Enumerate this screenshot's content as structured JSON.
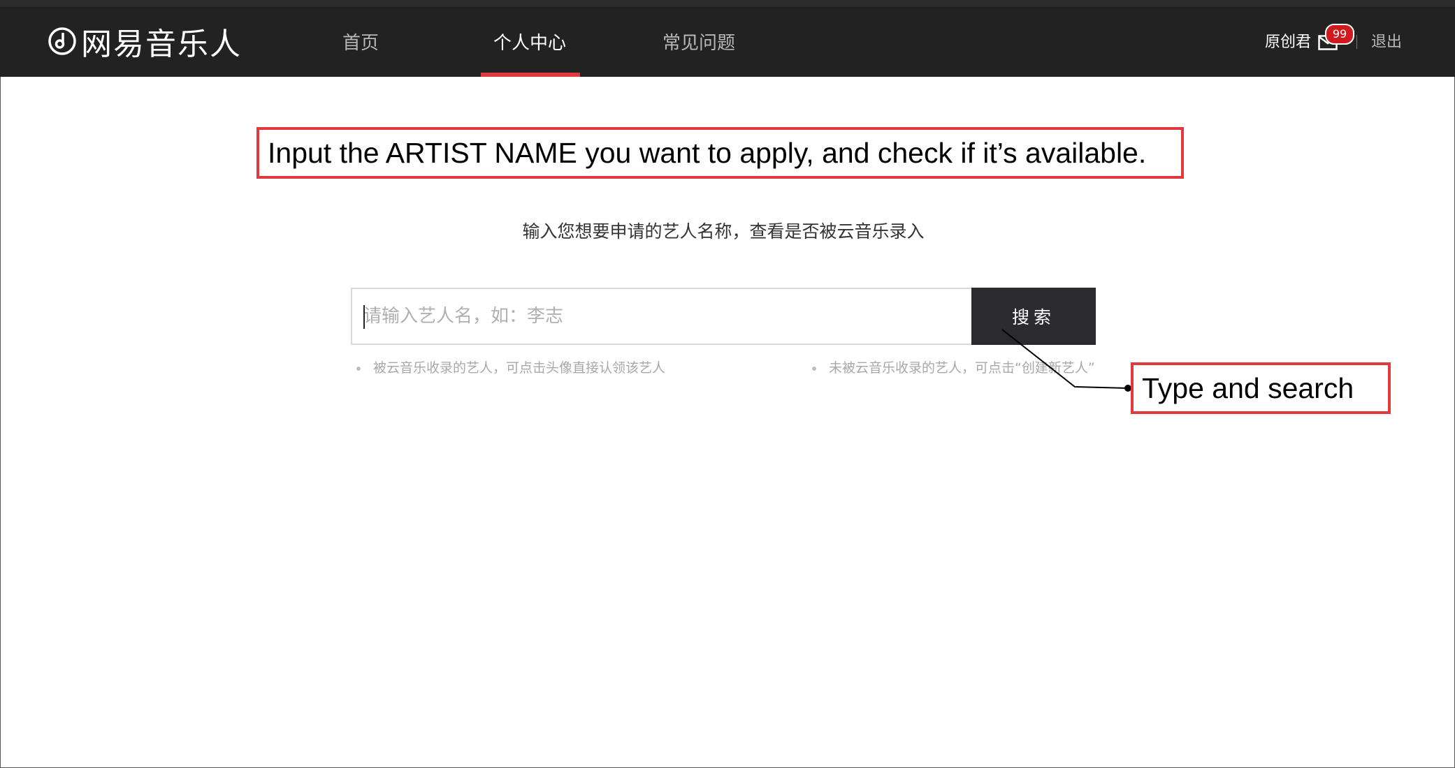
{
  "header": {
    "logo_text": "网易音乐人",
    "nav": [
      {
        "label": "首页",
        "active": false
      },
      {
        "label": "个人中心",
        "active": true
      },
      {
        "label": "常见问题",
        "active": false
      }
    ],
    "user_name": "原创君",
    "mail_badge": "99",
    "logout_label": "退出"
  },
  "annotations": {
    "top": "Input the ARTIST NAME you want to apply, and check if it’s available.",
    "right": "Type and search"
  },
  "main": {
    "subtitle": "输入您想要申请的艺人名称，查看是否被云音乐录入",
    "search": {
      "placeholder": "请输入艺人名，如：李志",
      "value": "",
      "button_label": "搜索"
    },
    "hints": [
      "被云音乐收录的艺人，可点击头像直接认领该艺人",
      "未被云音乐收录的艺人，可点击“创建新艺人”"
    ]
  },
  "colors": {
    "header_bg": "#222222",
    "accent": "#e03a3e",
    "badge": "#d01b1e",
    "button_bg": "#2b2b2f"
  }
}
